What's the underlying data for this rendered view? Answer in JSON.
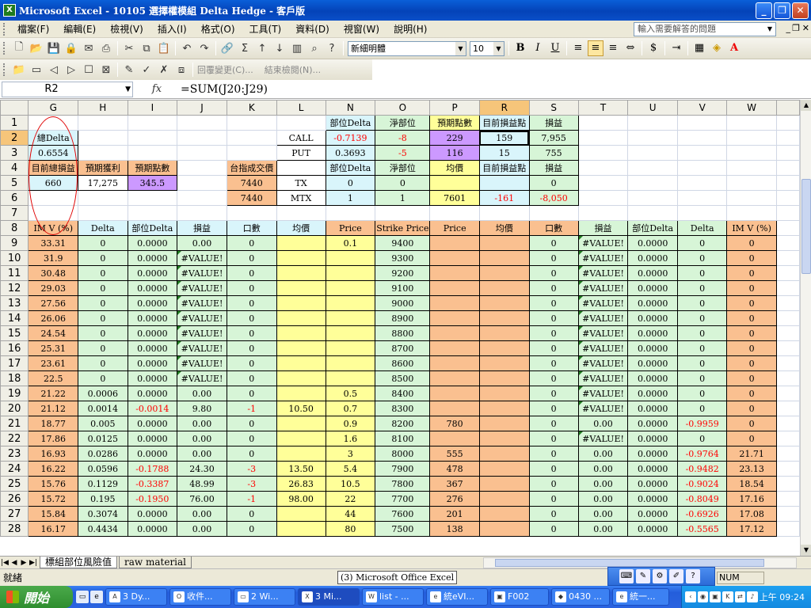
{
  "window": {
    "title": "Microsoft Excel - 10105 選擇權模組 Delta Hedge - 客戶版"
  },
  "menu": {
    "items": [
      "檔案(F)",
      "編輯(E)",
      "檢視(V)",
      "插入(I)",
      "格式(O)",
      "工具(T)",
      "資料(D)",
      "視窗(W)",
      "說明(H)"
    ],
    "help_placeholder": "輸入需要解答的問題"
  },
  "format_toolbar": {
    "font": "新細明體",
    "size": "10"
  },
  "review_toolbar": {
    "reply_text": "回覆變更(C)...",
    "end_review": "結束檢閱(N)..."
  },
  "formula_bar": {
    "name_box": "R2",
    "fx": "fx",
    "formula": "=SUM(J20:J29)"
  },
  "columns": [
    "G",
    "H",
    "I",
    "J",
    "K",
    "L",
    "N",
    "O",
    "P",
    "R",
    "S",
    "T",
    "U",
    "V",
    "W"
  ],
  "top_block": [
    [
      "",
      "",
      "",
      "",
      "",
      "",
      "部位Delta",
      "淨部位",
      "預期點數",
      "目前損益點",
      "損益",
      "",
      "",
      "",
      ""
    ],
    [
      "總Delta",
      "",
      "",
      "",
      "",
      "CALL",
      "-0.7139",
      "-8",
      "229",
      "159",
      "7,955",
      "",
      "",
      "",
      ""
    ],
    [
      "0.6554",
      "",
      "",
      "",
      "",
      "PUT",
      "0.3693",
      "-5",
      "116",
      "15",
      "755",
      "",
      "",
      "",
      ""
    ],
    [
      "目前總損益",
      "預期獲利",
      "預期點數",
      "",
      "台指成交價",
      "",
      "部位Delta",
      "淨部位",
      "均價",
      "目前損益點",
      "損益",
      "",
      "",
      "",
      ""
    ],
    [
      "660",
      "17,275",
      "345.5",
      "",
      "7440",
      "TX",
      "0",
      "0",
      "",
      "",
      "0",
      "",
      "",
      "",
      ""
    ],
    [
      "",
      "",
      "",
      "",
      "7440",
      "MTX",
      "1",
      "1",
      "7601",
      "-161",
      "-8,050",
      "",
      "",
      "",
      ""
    ],
    [
      "",
      "",
      "",
      "",
      "",
      "",
      "",
      "",
      "",
      "",
      "",
      "",
      "",
      "",
      ""
    ]
  ],
  "table_header": [
    "IM V (%)",
    "Delta",
    "部位Delta",
    "損益",
    "口數",
    "均價",
    "Price",
    "Strike Price",
    "Price",
    "均價",
    "口數",
    "損益",
    "部位Delta",
    "Delta",
    "IM V (%)"
  ],
  "table_rows": [
    [
      "33.31",
      "0",
      "0.0000",
      "0.00",
      "0",
      "",
      "0.1",
      "9400",
      "",
      "",
      "0",
      "#VALUE!",
      "0.0000",
      "0",
      "0"
    ],
    [
      "31.9",
      "0",
      "0.0000",
      "#VALUE!",
      "0",
      "",
      "",
      "9300",
      "",
      "",
      "0",
      "#VALUE!",
      "0.0000",
      "0",
      "0"
    ],
    [
      "30.48",
      "0",
      "0.0000",
      "#VALUE!",
      "0",
      "",
      "",
      "9200",
      "",
      "",
      "0",
      "#VALUE!",
      "0.0000",
      "0",
      "0"
    ],
    [
      "29.03",
      "0",
      "0.0000",
      "#VALUE!",
      "0",
      "",
      "",
      "9100",
      "",
      "",
      "0",
      "#VALUE!",
      "0.0000",
      "0",
      "0"
    ],
    [
      "27.56",
      "0",
      "0.0000",
      "#VALUE!",
      "0",
      "",
      "",
      "9000",
      "",
      "",
      "0",
      "#VALUE!",
      "0.0000",
      "0",
      "0"
    ],
    [
      "26.06",
      "0",
      "0.0000",
      "#VALUE!",
      "0",
      "",
      "",
      "8900",
      "",
      "",
      "0",
      "#VALUE!",
      "0.0000",
      "0",
      "0"
    ],
    [
      "24.54",
      "0",
      "0.0000",
      "#VALUE!",
      "0",
      "",
      "",
      "8800",
      "",
      "",
      "0",
      "#VALUE!",
      "0.0000",
      "0",
      "0"
    ],
    [
      "25.31",
      "0",
      "0.0000",
      "#VALUE!",
      "0",
      "",
      "",
      "8700",
      "",
      "",
      "0",
      "#VALUE!",
      "0.0000",
      "0",
      "0"
    ],
    [
      "23.61",
      "0",
      "0.0000",
      "#VALUE!",
      "0",
      "",
      "",
      "8600",
      "",
      "",
      "0",
      "#VALUE!",
      "0.0000",
      "0",
      "0"
    ],
    [
      "22.5",
      "0",
      "0.0000",
      "#VALUE!",
      "0",
      "",
      "",
      "8500",
      "",
      "",
      "0",
      "#VALUE!",
      "0.0000",
      "0",
      "0"
    ],
    [
      "21.22",
      "0.0006",
      "0.0000",
      "0.00",
      "0",
      "",
      "0.5",
      "8400",
      "",
      "",
      "0",
      "#VALUE!",
      "0.0000",
      "0",
      "0"
    ],
    [
      "21.12",
      "0.0014",
      "-0.0014",
      "9.80",
      "-1",
      "10.50",
      "0.7",
      "8300",
      "",
      "",
      "0",
      "#VALUE!",
      "0.0000",
      "0",
      "0"
    ],
    [
      "18.77",
      "0.005",
      "0.0000",
      "0.00",
      "0",
      "",
      "0.9",
      "8200",
      "780",
      "",
      "0",
      "0.00",
      "0.0000",
      "-0.9959",
      "0"
    ],
    [
      "17.86",
      "0.0125",
      "0.0000",
      "0.00",
      "0",
      "",
      "1.6",
      "8100",
      "",
      "",
      "0",
      "#VALUE!",
      "0.0000",
      "0",
      "0"
    ],
    [
      "16.93",
      "0.0286",
      "0.0000",
      "0.00",
      "0",
      "",
      "3",
      "8000",
      "555",
      "",
      "0",
      "0.00",
      "0.0000",
      "-0.9764",
      "21.71"
    ],
    [
      "16.22",
      "0.0596",
      "-0.1788",
      "24.30",
      "-3",
      "13.50",
      "5.4",
      "7900",
      "478",
      "",
      "0",
      "0.00",
      "0.0000",
      "-0.9482",
      "23.13"
    ],
    [
      "15.76",
      "0.1129",
      "-0.3387",
      "48.99",
      "-3",
      "26.83",
      "10.5",
      "7800",
      "367",
      "",
      "0",
      "0.00",
      "0.0000",
      "-0.9024",
      "18.54"
    ],
    [
      "15.72",
      "0.195",
      "-0.1950",
      "76.00",
      "-1",
      "98.00",
      "22",
      "7700",
      "276",
      "",
      "0",
      "0.00",
      "0.0000",
      "-0.8049",
      "17.16"
    ],
    [
      "15.84",
      "0.3074",
      "0.0000",
      "0.00",
      "0",
      "",
      "44",
      "7600",
      "201",
      "",
      "0",
      "0.00",
      "0.0000",
      "-0.6926",
      "17.08"
    ],
    [
      "16.17",
      "0.4434",
      "0.0000",
      "0.00",
      "0",
      "",
      "80",
      "7500",
      "138",
      "",
      "0",
      "0.00",
      "0.0000",
      "-0.5565",
      "17.12"
    ]
  ],
  "sheet_tabs": [
    "標組部位風險值",
    "raw material"
  ],
  "status": {
    "ready": "就緒",
    "num": "NUM",
    "tooltip": "(3) Microsoft Office Excel"
  },
  "taskbar": {
    "start": "開始",
    "tasks": [
      "3 Dy...",
      "收件...",
      "2 Wi...",
      "3 Mi...",
      "list - ...",
      "統eVI...",
      "F002",
      "0430 ...",
      "統一..."
    ],
    "clock": "上午 09:24"
  }
}
